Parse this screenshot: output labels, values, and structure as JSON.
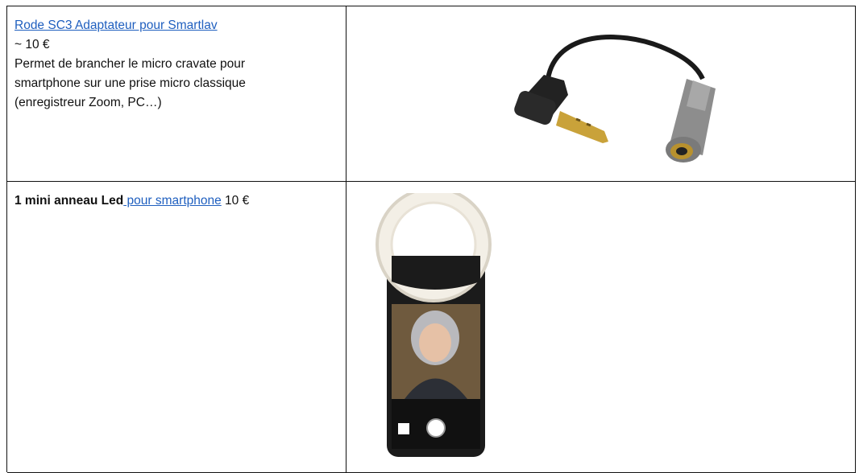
{
  "rows": [
    {
      "product_link": "Rode SC3 Adaptateur pour Smartlav",
      "price": "~ 10 €",
      "description_lines": [
        "Permet de brancher le micro cravate pour",
        "smartphone sur une prise micro classique",
        "(enregistreur Zoom, PC…)"
      ],
      "image_icon": "trrs-adapter-cable-image"
    },
    {
      "title_bold": "1 mini anneau Led",
      "title_link": " pour smartphone",
      "price": " 10 €",
      "image_icon": "ring-light-smartphone-image"
    }
  ],
  "colors": {
    "link": "#1f5fbf",
    "border": "#111111"
  }
}
